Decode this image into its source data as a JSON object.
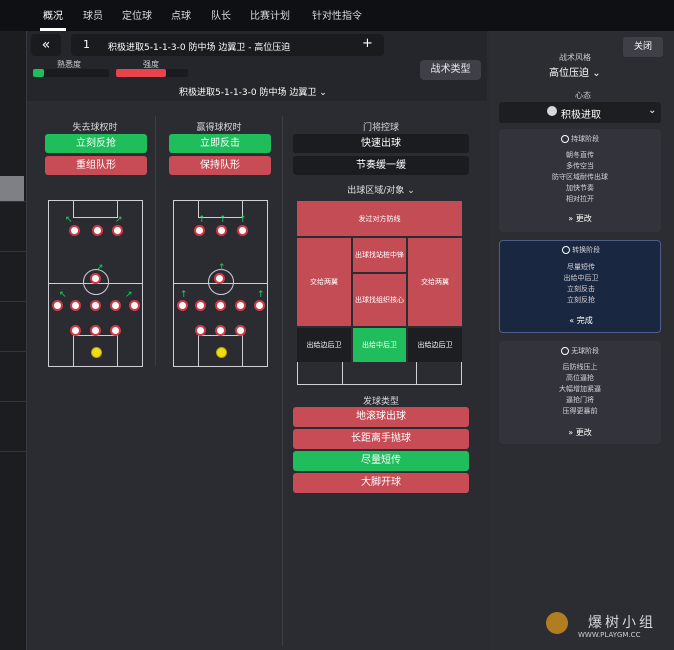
{
  "nav": {
    "tabs": [
      "概况",
      "球员",
      "定位球",
      "点球",
      "队长",
      "比赛计划",
      "针对性指令"
    ]
  },
  "header": {
    "back_icon": "«",
    "slot_number": "1",
    "tactic_title": "积极进取5-1-1-3-0 防中场 边翼卫 - 高位压迫",
    "add_icon": "+",
    "familiarity_label": "熟悉度",
    "intensity_label": "强度",
    "familiarity_level": 0.15,
    "intensity_level": 0.7,
    "tactic_type_button": "战术类型",
    "tactic_dropdown": "积极进取5-1-1-3-0 防中场 边翼卫"
  },
  "lose_ball": {
    "title": "失去球权时",
    "options": [
      {
        "label": "立刻反抢",
        "color": "green"
      },
      {
        "label": "重组队形",
        "color": "red"
      }
    ]
  },
  "win_ball": {
    "title": "赢得球权时",
    "options": [
      {
        "label": "立即反击",
        "color": "green"
      },
      {
        "label": "保持队形",
        "color": "red"
      }
    ]
  },
  "gk_control": {
    "title": "门将控球",
    "options": [
      {
        "label": "快速出球",
        "color": "dark"
      },
      {
        "label": "节奏缓一缓",
        "color": "dark"
      }
    ]
  },
  "distribution_area": {
    "title": "出球区域/对象",
    "zones": {
      "top": "发过对方防线",
      "center_top": "出球找站桩中锋",
      "left_mid": "交给两翼",
      "right_mid": "交给两翼",
      "center_bottom": "出球找组织核心",
      "bottom_left": "出给边后卫",
      "bottom_center": "出给中后卫",
      "bottom_right": "出给边后卫"
    }
  },
  "distribution_type": {
    "title": "发球类型",
    "options": [
      {
        "label": "地滚球出球",
        "color": "red"
      },
      {
        "label": "长距离手抛球",
        "color": "red"
      },
      {
        "label": "尽量短传",
        "color": "green"
      },
      {
        "label": "大脚开球",
        "color": "red"
      }
    ]
  },
  "sidebar": {
    "close": "关闭",
    "style_label": "战术风格",
    "style_value": "高位压迫",
    "mentality_label": "心态",
    "mentality_value": "积极进取",
    "phases": [
      {
        "title": "持球阶段",
        "items": [
          "朝冬直传",
          "多传空当",
          "防守区域耐传出球",
          "加快节奏",
          "相对拉开"
        ],
        "action": "更改",
        "selected": false
      },
      {
        "title": "转换阶段",
        "items": [
          "尽量短传",
          "出给中后卫",
          "立刻反击",
          "立刻反抢"
        ],
        "action": "完成",
        "selected": true
      },
      {
        "title": "无球阶段",
        "items": [
          "后防线压上",
          "高位逼抢",
          "大幅增加紧逼",
          "逼抢门将",
          "压得更暴前"
        ],
        "action": "更改",
        "selected": false
      }
    ]
  },
  "watermark": {
    "text": "爆树小组",
    "url": "WWW.PLAYGM.CC"
  }
}
